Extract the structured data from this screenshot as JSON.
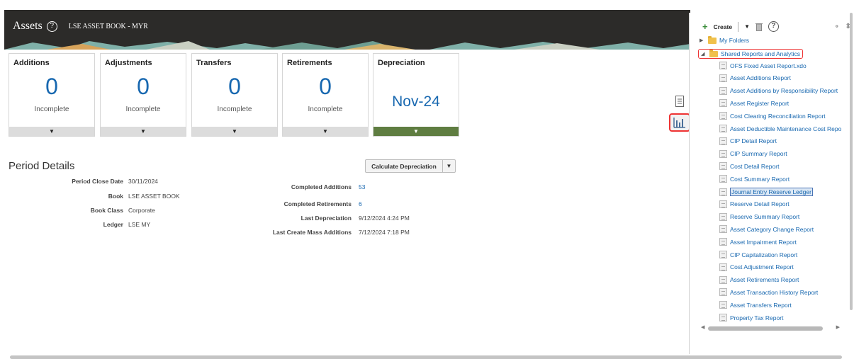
{
  "header": {
    "title": "Assets",
    "subtitle": "LSE ASSET BOOK - MYR"
  },
  "tiles": [
    {
      "title": "Additions",
      "value": "0",
      "caption": "Incomplete"
    },
    {
      "title": "Adjustments",
      "value": "0",
      "caption": "Incomplete"
    },
    {
      "title": "Transfers",
      "value": "0",
      "caption": "Incomplete"
    },
    {
      "title": "Retirements",
      "value": "0",
      "caption": "Incomplete"
    },
    {
      "title": "Depreciation",
      "value": "Nov-24",
      "caption": ""
    }
  ],
  "period": {
    "title": "Period Details",
    "left": [
      {
        "label": "Period Close Date",
        "value": "30/11/2024"
      },
      {
        "label": "Book",
        "value": "LSE ASSET BOOK"
      },
      {
        "label": "Book Class",
        "value": "Corporate"
      },
      {
        "label": "Ledger",
        "value": "LSE MY"
      }
    ],
    "right": [
      {
        "label": "Completed Additions",
        "value": "53"
      },
      {
        "label": "Completed Retirements",
        "value": "6"
      },
      {
        "label": "Last Depreciation",
        "value": "9/12/2024 4:24 PM"
      },
      {
        "label": "Last Create Mass Additions",
        "value": "7/12/2024 7:18 PM"
      }
    ],
    "calc_button": "Calculate Depreciation"
  },
  "panel": {
    "create_label": "Create",
    "folders": [
      {
        "label": "My Folders",
        "expanded": false
      },
      {
        "label": "Shared Reports and Analytics",
        "expanded": true
      }
    ],
    "reports": [
      "OFS Fixed Asset Report.xdo",
      "Asset Additions Report",
      "Asset Additions by Responsibility Report",
      "Asset Register Report",
      "Cost Clearing Reconciliation Report",
      "Asset Deductible Maintenance Cost Repo",
      "CIP Detail Report",
      "CIP Summary Report",
      "Cost Detail Report",
      "Cost Summary Report",
      "Journal Entry Reserve Ledger",
      "Reserve Detail Report",
      "Reserve Summary Report",
      "Asset Category Change Report",
      "Asset Impairment Report",
      "CIP Capitalization Report",
      "Cost Adjustment Report",
      "Asset Retirements Report",
      "Asset Transaction History Report",
      "Asset Transfers Report",
      "Property Tax Report"
    ],
    "selected_report": "Journal Entry Reserve Ledger"
  },
  "colors": {
    "accent": "#1868b0",
    "banner": "#2c2b29",
    "depreciation_bar": "#5f7d41",
    "highlight_border": "#e33333"
  },
  "icons": {
    "help": "help-circle-icon",
    "side_tasks": "document-icon",
    "side_reports": "bar-chart-icon"
  }
}
